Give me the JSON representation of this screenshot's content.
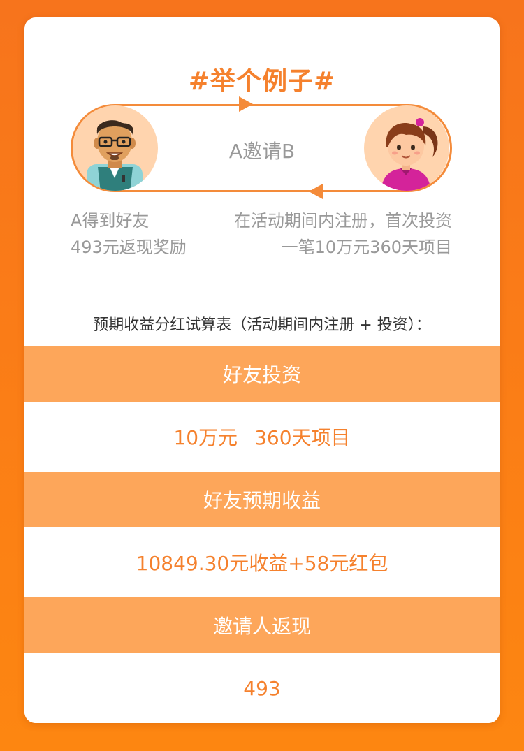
{
  "title": "#举个例子#",
  "invite": {
    "label": "A邀请B",
    "left_desc": [
      "A得到好友",
      "493元返现奖励"
    ],
    "right_desc": [
      "在活动期间内注册，首次投资",
      "一笔10万元360天项目"
    ]
  },
  "table": {
    "caption": "预期收益分红试算表（活动期间内注册 + 投资）：",
    "rows": [
      {
        "header": "好友投资",
        "value": [
          "10万元",
          "360天项目"
        ]
      },
      {
        "header": "好友预期收益",
        "value": "10849.30元收益+58元红包"
      },
      {
        "header": "邀请人返现",
        "value": "493"
      }
    ]
  },
  "colors": {
    "accent": "#f5812d",
    "row_header_bg": "#fda65a",
    "page_bg": "#f7741c"
  },
  "icons": [
    "man-avatar-icon",
    "woman-avatar-icon",
    "arrow-right-icon",
    "arrow-left-icon"
  ]
}
